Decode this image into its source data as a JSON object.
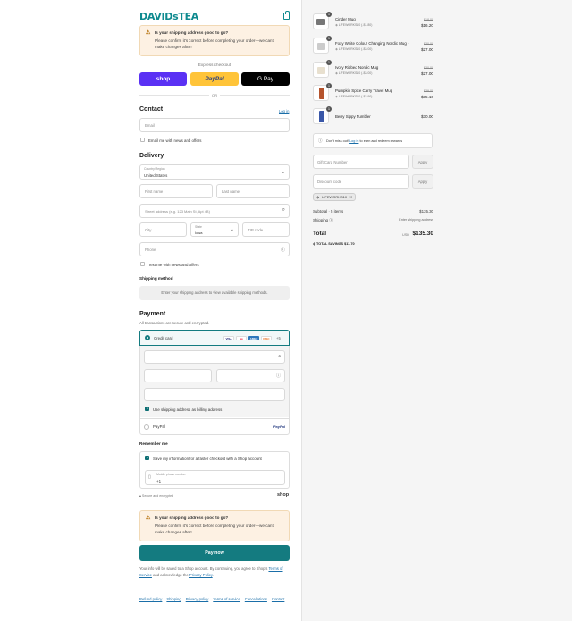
{
  "brand": {
    "logo": "DAVIDsTEA",
    "accent": "#0e8a8f"
  },
  "warning_top": {
    "title": "Is your shipping address good to go?",
    "text": "Please confirm it's correct before completing your order—we can't make changes after!"
  },
  "express": {
    "label": "Express checkout",
    "shop": "shop",
    "paypal": "PayPal",
    "gpay": "G Pay",
    "or": "OR"
  },
  "contact": {
    "heading": "Contact",
    "login_link": "Log in",
    "email_placeholder": "Email",
    "news_label": "Email me with news and offers"
  },
  "delivery": {
    "heading": "Delivery",
    "country_label": "Country/Region",
    "country_value": "United States",
    "first_name": "First name",
    "last_name": "Last name",
    "address": "Street address (e.g. 123 Main St, Apt 4B)",
    "city": "City",
    "state_label": "State",
    "state_value": "Iowa",
    "zip": "ZIP code",
    "phone": "Phone",
    "text_label": "Text me with news and offers"
  },
  "shipping_method": {
    "heading": "Shipping method",
    "placeholder": "Enter your shipping address to view available shipping methods."
  },
  "payment": {
    "heading": "Payment",
    "subtext": "All transactions are secure and encrypted.",
    "credit_card": "Credit card",
    "cards": [
      "VISA",
      "MC",
      "AMEX",
      "DISC"
    ],
    "more": "+5",
    "billing_label": "Use shipping address as billing address",
    "paypal": "PayPal"
  },
  "remember": {
    "heading": "Remember me",
    "save_label": "Save my information for a faster checkout with a Shop account",
    "mobile_label": "Mobile phone number",
    "mobile_value": "+1",
    "secure": "Secure and encrypted",
    "shop": "shop"
  },
  "warning_bottom": {
    "title": "Is your shipping address good to go?",
    "text": "Please confirm it's correct before completing your order—we can't make changes after!"
  },
  "pay_now": "Pay now",
  "legal": {
    "text1": "Your info will be saved to a Shop account. By continuing, you agree to Shop's",
    "terms": "Terms of Service",
    "text2": "and acknowledge the",
    "privacy": "Privacy Policy",
    "end": "."
  },
  "footer_links": [
    "Refund policy",
    "Shipping",
    "Privacy policy",
    "Terms of service",
    "Cancellations",
    "Contact"
  ],
  "cart": {
    "items": [
      {
        "qty": "1",
        "name": "Cinder Mug",
        "discount": "LIFEWORKS10 (-$1.80)",
        "old": "$18.00",
        "price": "$16.20"
      },
      {
        "qty": "1",
        "name": "Foxy White Colour Changing Nordic Mug -",
        "discount": "LIFEWORKS10 (-$3.00)",
        "old": "$30.00",
        "price": "$27.00"
      },
      {
        "qty": "1",
        "name": "Ivory Ribbed Nordic Mug",
        "discount": "LIFEWORKS10 (-$3.00)",
        "old": "$30.00",
        "price": "$27.00"
      },
      {
        "qty": "1",
        "name": "Pumpkin Spice Carry Travel Mug",
        "discount": "LIFEWORKS10 (-$3.90)",
        "old": "$39.00",
        "price": "$35.10"
      },
      {
        "qty": "1",
        "name": "Berry Sippy Tumbler",
        "discount": "",
        "old": "",
        "price": "$30.00"
      }
    ],
    "rewards_pre": "Don't miss out!",
    "rewards_link": "Log in",
    "rewards_post": "to earn and redeem rewards",
    "gift_placeholder": "Gift Card Number",
    "discount_placeholder": "Discount code",
    "apply": "Apply",
    "applied_code": "LIFEWORKS10",
    "subtotal_label": "Subtotal · 5 items",
    "subtotal": "$135.30",
    "shipping_label": "Shipping",
    "shipping_value": "Enter shipping address",
    "total_label": "Total",
    "currency": "USD",
    "total": "$135.30",
    "savings_label": "TOTAL SAVINGS",
    "savings": "$11.70"
  }
}
